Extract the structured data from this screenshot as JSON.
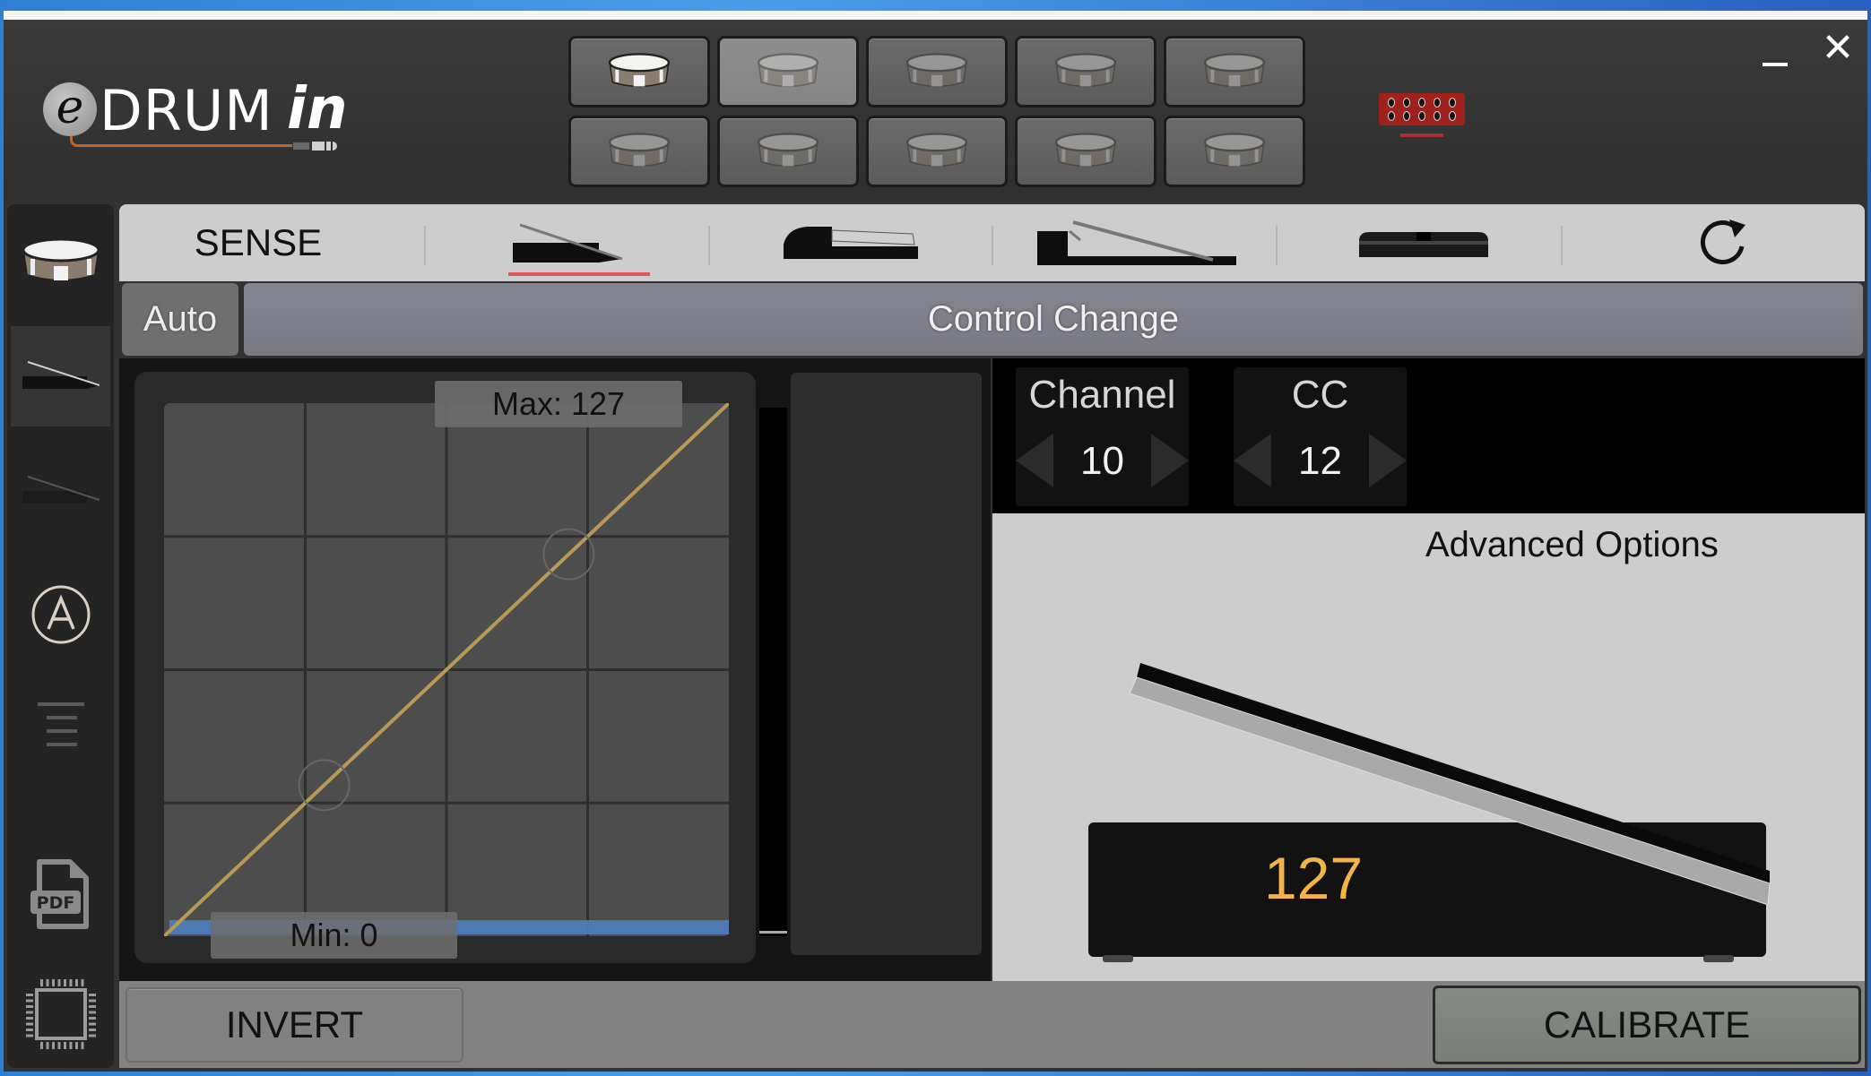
{
  "app": {
    "logo": {
      "e": "e",
      "drum": "DRUM",
      "in": "in"
    },
    "window_controls": {
      "minimize": "–",
      "close": "✕"
    }
  },
  "pads": [
    {
      "index": 1,
      "icon": "snare-drum-icon",
      "state": "active"
    },
    {
      "index": 2,
      "icon": "snare-drum-icon",
      "state": "selected"
    },
    {
      "index": 3,
      "icon": "snare-drum-icon",
      "state": "inactive"
    },
    {
      "index": 4,
      "icon": "snare-drum-icon",
      "state": "inactive"
    },
    {
      "index": 5,
      "icon": "snare-drum-icon",
      "state": "inactive"
    },
    {
      "index": 6,
      "icon": "snare-drum-icon",
      "state": "inactive"
    },
    {
      "index": 7,
      "icon": "snare-drum-icon",
      "state": "inactive"
    },
    {
      "index": 8,
      "icon": "snare-drum-icon",
      "state": "inactive"
    },
    {
      "index": 9,
      "icon": "snare-drum-icon",
      "state": "inactive"
    },
    {
      "index": 10,
      "icon": "snare-drum-icon",
      "state": "inactive"
    }
  ],
  "connector": {
    "icon": "connector-port-icon",
    "color": "#a0201c"
  },
  "sidebar": {
    "items": [
      {
        "name": "pad",
        "icon": "snare-drum-icon",
        "selected": false
      },
      {
        "name": "pedal-1",
        "icon": "expression-pedal-icon",
        "selected": true
      },
      {
        "name": "pedal-2",
        "icon": "expression-pedal-icon",
        "selected": false
      },
      {
        "name": "auto",
        "icon": "circle-a-icon",
        "selected": false
      },
      {
        "name": "menu",
        "icon": "list-icon",
        "selected": false
      },
      {
        "name": "pdf",
        "icon": "pdf-icon",
        "selected": false
      },
      {
        "name": "firmware",
        "icon": "chip-icon",
        "selected": false
      }
    ]
  },
  "tabs": {
    "sense_label": "SENSE",
    "items": [
      {
        "name": "expression-pedal",
        "icon": "expression-pedal-icon",
        "selected": true
      },
      {
        "name": "sustain-pedal",
        "icon": "sustain-pedal-icon",
        "selected": false
      },
      {
        "name": "hihat-controller",
        "icon": "hihat-controller-icon",
        "selected": false
      },
      {
        "name": "footswitch",
        "icon": "footswitch-icon",
        "selected": false
      }
    ],
    "refresh_icon": "refresh-icon",
    "accent": "#e05555"
  },
  "mode": {
    "auto_label": "Auto",
    "message_type": "Control Change"
  },
  "curve": {
    "max_label": "Max: 127",
    "min_label": "Min: 0",
    "max": 127,
    "min": 0,
    "grid_divisions": 4,
    "points": [
      [
        0,
        0
      ],
      [
        127,
        127
      ]
    ],
    "handles": [
      [
        36,
        36
      ],
      [
        91,
        91
      ]
    ],
    "line_color": "#b89a55",
    "min_bar_color": "#4f7fbf"
  },
  "meter": {
    "level": 0
  },
  "midi": {
    "channel_label": "Channel",
    "channel_value": "10",
    "cc_label": "CC",
    "cc_value": "12"
  },
  "advanced": {
    "title": "Advanced Options",
    "pedal_value": "127",
    "pedal_position": 1.0,
    "value_color": "#f3b347"
  },
  "bottom": {
    "invert_label": "INVERT",
    "calibrate_label": "CALIBRATE"
  }
}
